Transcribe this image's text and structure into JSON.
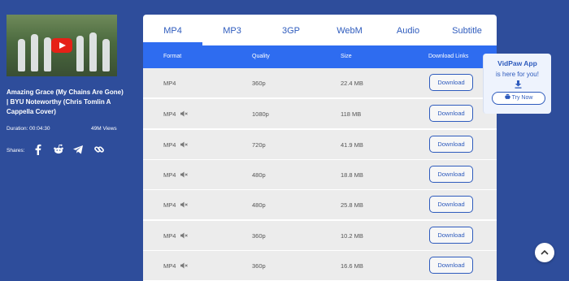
{
  "video": {
    "title": "Amazing Grace (My Chains Are Gone) | BYU Noteworthy (Chris Tomlin A Cappella Cover)",
    "duration": "Duration: 00:04:30",
    "views": "49M Views",
    "shares_label": "Shares:",
    "share_icons": [
      "facebook-icon",
      "reddit-icon",
      "telegram-icon",
      "link-icon"
    ]
  },
  "tabs": [
    "MP4",
    "MP3",
    "3GP",
    "WebM",
    "Audio",
    "Subtitle"
  ],
  "active_tab": "MP4",
  "table": {
    "headers": [
      "Format",
      "Quality",
      "Size",
      "Download Links"
    ],
    "rows": [
      {
        "format": "MP4",
        "muted": false,
        "quality": "360p",
        "size": "22.4 MB",
        "button": "Download"
      },
      {
        "format": "MP4",
        "muted": true,
        "quality": "1080p",
        "size": "118 MB",
        "button": "Download"
      },
      {
        "format": "MP4",
        "muted": true,
        "quality": "720p",
        "size": "41.9 MB",
        "button": "Download"
      },
      {
        "format": "MP4",
        "muted": true,
        "quality": "480p",
        "size": "18.8 MB",
        "button": "Download"
      },
      {
        "format": "MP4",
        "muted": true,
        "quality": "480p",
        "size": "25.8 MB",
        "button": "Download"
      },
      {
        "format": "MP4",
        "muted": true,
        "quality": "360p",
        "size": "10.2 MB",
        "button": "Download"
      },
      {
        "format": "MP4",
        "muted": true,
        "quality": "360p",
        "size": "16.6 MB",
        "button": "Download"
      }
    ]
  },
  "promo": {
    "title": "VidPaw App",
    "subtitle": "is here for you!",
    "button": "Try Now"
  },
  "colors": {
    "background": "#2e4d9b",
    "accent": "#2e6cf0",
    "link": "#2e5bbd",
    "row": "#ececec"
  }
}
